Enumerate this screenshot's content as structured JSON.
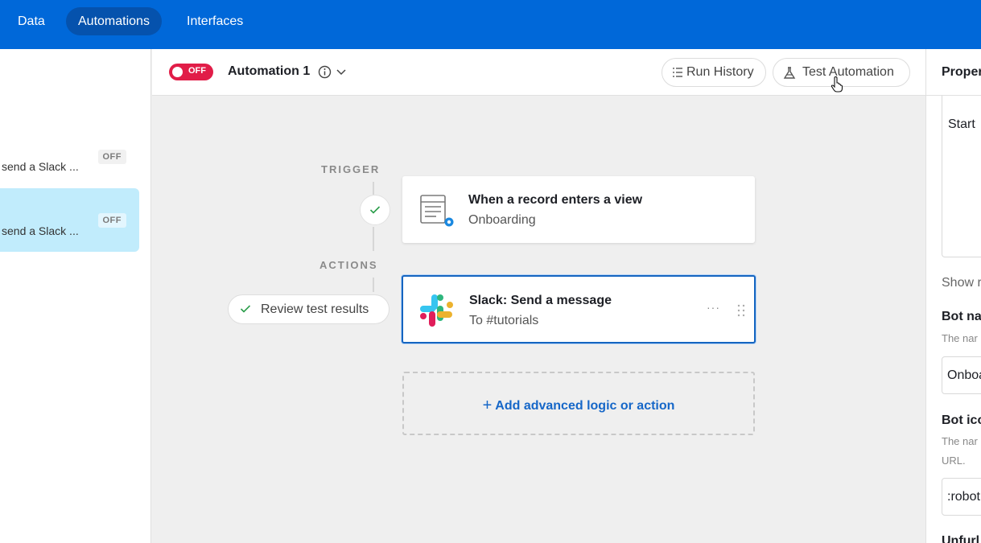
{
  "topnav": {
    "tabs": [
      "Data",
      "Automations",
      "Interfaces"
    ],
    "active": "Automations"
  },
  "sidebar": {
    "items": [
      {
        "label": "send a Slack ...",
        "status": "OFF"
      },
      {
        "label": "send a Slack ...",
        "status": "OFF"
      }
    ]
  },
  "header": {
    "toggle_label": "OFF",
    "automation_name": "Automation 1",
    "run_history_label": "Run History",
    "test_label": "Test Automation"
  },
  "canvas": {
    "trigger_label": "TRIGGER",
    "actions_label": "ACTIONS",
    "trigger_card": {
      "title": "When a record enters a view",
      "subtitle": "Onboarding"
    },
    "action_card": {
      "title": "Slack: Send a message",
      "subtitle": "To #tutorials",
      "more": "···"
    },
    "review_label": "Review test results",
    "add_label": "Add advanced logic or action"
  },
  "right_panel": {
    "heading": "Proper",
    "start_text": "Start",
    "show_more": "Show r",
    "bot_name_label": "Bot na",
    "bot_name_help": "The nar",
    "bot_name_value": "Onboa",
    "bot_icon_label": "Bot ico",
    "bot_icon_help_1": "The nar",
    "bot_icon_help_2": "URL.",
    "bot_icon_value": ":robot",
    "unfurl_label": "Unfurl"
  },
  "colors": {
    "topbar": "#0068d9",
    "toggle_off": "#e11d48",
    "accent": "#1565c0",
    "selected_item": "#c1ecfc"
  }
}
